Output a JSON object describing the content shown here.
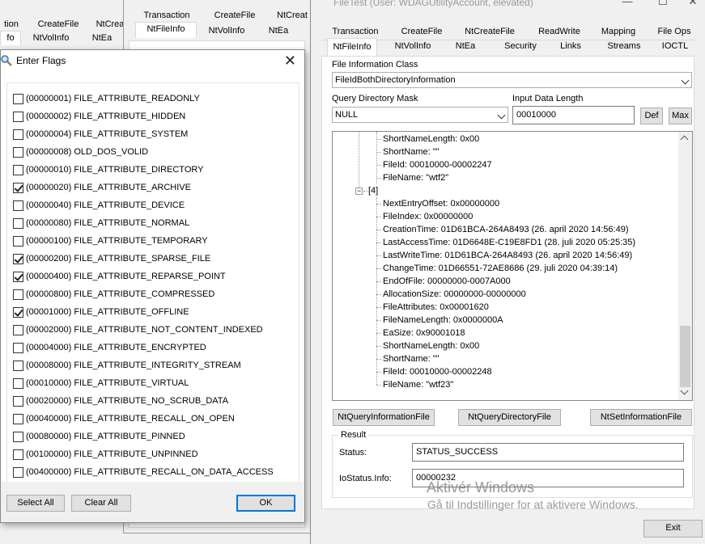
{
  "back_window_left": {
    "tabs_row1": [
      "tion",
      "CreateFile",
      "NtCrea"
    ],
    "tabs_row2": [
      "fo",
      "NtVolInfo",
      "NtEa"
    ]
  },
  "back_window_mid": {
    "tabs_row1": [
      "Transaction",
      "CreateFile",
      "NtCreat"
    ],
    "tabs_row2": [
      "NtFileInfo",
      "NtVolInfo",
      "NtEa"
    ]
  },
  "flags_dialog": {
    "title": "Enter Flags",
    "flags": [
      {
        "label": "(00000001) FILE_ATTRIBUTE_READONLY",
        "checked": false
      },
      {
        "label": "(00000002) FILE_ATTRIBUTE_HIDDEN",
        "checked": false
      },
      {
        "label": "(00000004) FILE_ATTRIBUTE_SYSTEM",
        "checked": false
      },
      {
        "label": "(00000008) OLD_DOS_VOLID",
        "checked": false
      },
      {
        "label": "(00000010) FILE_ATTRIBUTE_DIRECTORY",
        "checked": false
      },
      {
        "label": "(00000020) FILE_ATTRIBUTE_ARCHIVE",
        "checked": true
      },
      {
        "label": "(00000040) FILE_ATTRIBUTE_DEVICE",
        "checked": false
      },
      {
        "label": "(00000080) FILE_ATTRIBUTE_NORMAL",
        "checked": false
      },
      {
        "label": "(00000100) FILE_ATTRIBUTE_TEMPORARY",
        "checked": false
      },
      {
        "label": "(00000200) FILE_ATTRIBUTE_SPARSE_FILE",
        "checked": true
      },
      {
        "label": "(00000400) FILE_ATTRIBUTE_REPARSE_POINT",
        "checked": true
      },
      {
        "label": "(00000800) FILE_ATTRIBUTE_COMPRESSED",
        "checked": false
      },
      {
        "label": "(00001000) FILE_ATTRIBUTE_OFFLINE",
        "checked": true
      },
      {
        "label": "(00002000) FILE_ATTRIBUTE_NOT_CONTENT_INDEXED",
        "checked": false
      },
      {
        "label": "(00004000) FILE_ATTRIBUTE_ENCRYPTED",
        "checked": false
      },
      {
        "label": "(00008000) FILE_ATTRIBUTE_INTEGRITY_STREAM",
        "checked": false
      },
      {
        "label": "(00010000) FILE_ATTRIBUTE_VIRTUAL",
        "checked": false
      },
      {
        "label": "(00020000) FILE_ATTRIBUTE_NO_SCRUB_DATA",
        "checked": false
      },
      {
        "label": "(00040000) FILE_ATTRIBUTE_RECALL_ON_OPEN",
        "checked": false
      },
      {
        "label": "(00080000) FILE_ATTRIBUTE_PINNED",
        "checked": false
      },
      {
        "label": "(00100000) FILE_ATTRIBUTE_UNPINNED",
        "checked": false
      },
      {
        "label": "(00400000) FILE_ATTRIBUTE_RECALL_ON_DATA_ACCESS",
        "checked": false
      }
    ],
    "select_all_label": "Select All",
    "clear_all_label": "Clear All",
    "ok_label": "OK"
  },
  "main_window": {
    "caption": "FileTest (User: WDAGUtilityAccount, elevated)",
    "tabs_row1": [
      "Transaction",
      "CreateFile",
      "NtCreateFile",
      "ReadWrite",
      "Mapping",
      "File Ops"
    ],
    "tabs_row2": [
      "NtFileInfo",
      "NtVolInfo",
      "NtEa",
      "Security",
      "Links",
      "Streams",
      "IOCTL"
    ],
    "file_info_class_label": "File Information Class",
    "file_info_class_value": "FileIdBothDirectoryInformation",
    "query_mask_label": "Query Directory Mask",
    "query_mask_value": "NULL",
    "input_length_label": "Input Data Length",
    "input_length_value": "00010000",
    "def_label": "Def",
    "max_label": "Max",
    "tree_top": [
      "ShortNameLength: 0x00",
      "ShortName: \"\"",
      "FileId: 00010000-00002247",
      "FileName: \"wtf2\""
    ],
    "tree_node": "[4]",
    "tree_items": [
      "NextEntryOffset: 0x00000000",
      "FileIndex: 0x00000000",
      "CreationTime: 01D61BCA-264A8493 (26. april 2020 14:56:49)",
      "LastAccessTime: 01D6648E-C19E8FD1 (28. juli 2020 05:25:35)",
      "LastWriteTime: 01D61BCA-264A8493 (26. april 2020 14:56:49)",
      "ChangeTime: 01D66551-72AE8686 (29. juli 2020 04:39:14)",
      "EndOfFile: 00000000-0007A000",
      "AllocationSize: 00000000-00000000",
      "FileAttributes: 0x00001620",
      "FileNameLength: 0x0000000A",
      "EaSize: 0x90001018",
      "ShortNameLength: 0x00",
      "ShortName: \"\"",
      "FileId: 00010000-00002248",
      "FileName: \"wtf23\""
    ],
    "btn_query_info": "NtQueryInformationFile",
    "btn_query_dir": "NtQueryDirectoryFile",
    "btn_set_info": "NtSetInformationFile",
    "result_label": "Result",
    "status_label": "Status:",
    "status_value": "STATUS_SUCCESS",
    "iostatus_label": "IoStatus.Info:",
    "iostatus_value": "00000232",
    "exit_label": "Exit"
  },
  "watermark": {
    "line1": "Aktivér Windows",
    "line2": "Gå til Indstillinger for at aktivere Windows."
  }
}
